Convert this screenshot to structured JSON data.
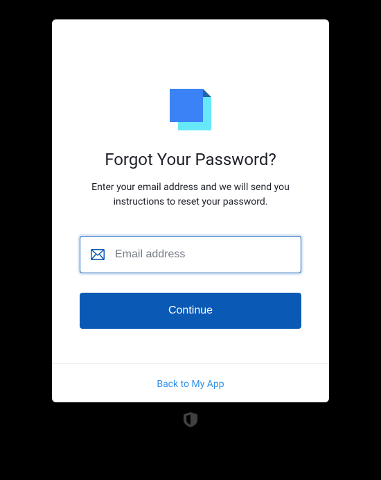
{
  "colors": {
    "accent": "#0a5ab5",
    "link": "#2f90e6",
    "logo_front": "#3b82f6",
    "logo_back": "#67e8f9"
  },
  "page": {
    "title": "Forgot Your Password?",
    "subtitle": "Enter your email address and we will send you instructions to reset your password."
  },
  "form": {
    "email_placeholder": "Email address",
    "email_value": "",
    "continue_label": "Continue"
  },
  "footer": {
    "back_link_label": "Back to My App"
  }
}
